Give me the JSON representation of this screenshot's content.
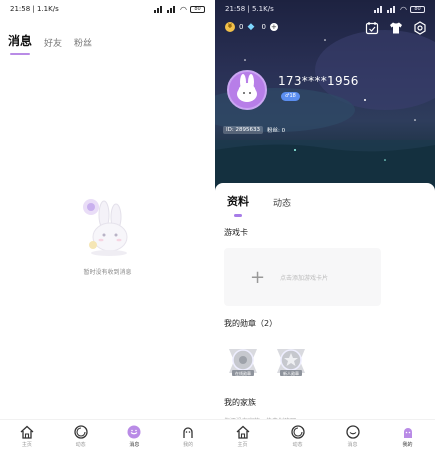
{
  "left": {
    "status": {
      "time": "21:58 | 1.1K/s",
      "battery": "80"
    },
    "tabs": [
      {
        "label": "消息",
        "active": true
      },
      {
        "label": "好友",
        "active": false
      },
      {
        "label": "粉丝",
        "active": false
      }
    ],
    "empty_text": "暂时没有收到消息",
    "nav": [
      {
        "label": "主页",
        "icon": "home-icon"
      },
      {
        "label": "动态",
        "icon": "moment-icon"
      },
      {
        "label": "消息",
        "icon": "message-icon",
        "active": true
      },
      {
        "label": "我的",
        "icon": "profile-icon"
      }
    ]
  },
  "right": {
    "status": {
      "time": "21:58 | 5.1K/s",
      "battery": "80"
    },
    "wallet": {
      "coins": "0",
      "gems": "0",
      "plus": "+"
    },
    "user": {
      "name": "173****1956",
      "badge": "♂18",
      "id": "ID: 2895633",
      "fans": "粉丝: 0"
    },
    "tabs": [
      {
        "label": "资料",
        "active": true
      },
      {
        "label": "动态",
        "active": false
      }
    ],
    "game_card": {
      "title": "游戏卡",
      "plus": "+",
      "hint": "点击添加游戏卡片"
    },
    "medals": {
      "title": "我的勋章（2）",
      "items": [
        {
          "label": "在线勋章"
        },
        {
          "label": "新人勋章"
        }
      ]
    },
    "family": {
      "title": "我的家族",
      "preview": "你还没有家族，快去创建吧"
    },
    "nav": [
      {
        "label": "主页",
        "icon": "home-icon"
      },
      {
        "label": "动态",
        "icon": "moment-icon"
      },
      {
        "label": "消息",
        "icon": "message-icon"
      },
      {
        "label": "我的",
        "icon": "profile-icon",
        "active": true
      }
    ]
  },
  "colors": {
    "accent": "#b98be6",
    "avatar": "#b77ee8",
    "badge": "#5b8ef0",
    "hero_top": "#1d2240"
  }
}
